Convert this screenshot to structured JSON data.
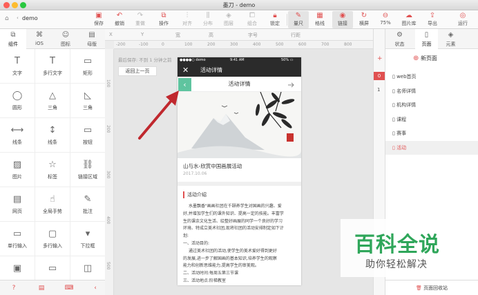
{
  "window": {
    "title": "墨刀 - demo",
    "doc_name": "demo"
  },
  "toolbar": {
    "items": [
      {
        "label": "保存",
        "icon": "save-icon"
      },
      {
        "label": "撤销",
        "icon": "undo-icon"
      },
      {
        "label": "重做",
        "icon": "redo-icon"
      },
      {
        "label": "操作",
        "icon": "operation-icon"
      },
      {
        "label": "对齐",
        "icon": "align-icon"
      },
      {
        "label": "分布",
        "icon": "distribute-icon"
      },
      {
        "label": "图层",
        "icon": "layer-icon"
      },
      {
        "label": "组合",
        "icon": "group-icon"
      },
      {
        "label": "锁定",
        "icon": "lock-icon"
      },
      {
        "label": "量尺",
        "icon": "ruler-icon"
      },
      {
        "label": "格线",
        "icon": "grid-icon"
      },
      {
        "label": "链接",
        "icon": "link-icon"
      },
      {
        "label": "横屏",
        "icon": "rotate-icon"
      },
      {
        "label": "75%",
        "icon": "zoom-icon"
      },
      {
        "label": "图片库",
        "icon": "image-library-icon"
      },
      {
        "label": "导出",
        "icon": "export-icon"
      },
      {
        "label": "运行",
        "icon": "run-icon"
      }
    ]
  },
  "left_tabs": [
    {
      "label": "组件",
      "icon": "component-icon"
    },
    {
      "label": "iOS",
      "icon": "apple-icon"
    },
    {
      "label": "图标",
      "icon": "emoji-icon"
    },
    {
      "label": "母版",
      "icon": "master-icon"
    }
  ],
  "components": [
    {
      "label": "文字",
      "icon": "T"
    },
    {
      "label": "多行文字",
      "icon": "T"
    },
    {
      "label": "矩形",
      "icon": "▭"
    },
    {
      "label": "圆形",
      "icon": "◯"
    },
    {
      "label": "三角",
      "icon": "△"
    },
    {
      "label": "三角",
      "icon": "◺"
    },
    {
      "label": "线条",
      "icon": "⟷"
    },
    {
      "label": "线条",
      "icon": "↕"
    },
    {
      "label": "按钮",
      "icon": "▭"
    },
    {
      "label": "图片",
      "icon": "▨"
    },
    {
      "label": "标签",
      "icon": "☆"
    },
    {
      "label": "链接区域",
      "icon": "⛓"
    },
    {
      "label": "网页",
      "icon": "▤"
    },
    {
      "label": "全局手势",
      "icon": "☝"
    },
    {
      "label": "批注",
      "icon": "✎"
    },
    {
      "label": "单行输入",
      "icon": "▭"
    },
    {
      "label": "多行输入",
      "icon": "▢"
    },
    {
      "label": "下拉框",
      "icon": "▾"
    },
    {
      "label": "",
      "icon": "▣"
    },
    {
      "label": "",
      "icon": "▭"
    },
    {
      "label": "",
      "icon": "◫"
    }
  ],
  "left_footer": [
    "help-icon",
    "doc-icon",
    "keyboard-icon",
    "collapse-icon"
  ],
  "propbar": {
    "x": "X",
    "y": "Y",
    "w": "宽",
    "h": "高",
    "font": "字号",
    "space": "行距"
  },
  "ruler_h": [
    "-200",
    "-100",
    "0",
    "100",
    "200",
    "300",
    "400",
    "500",
    "600",
    "700",
    "800"
  ],
  "ruler_v": [
    "100",
    "200",
    "300",
    "400",
    "500"
  ],
  "canvas": {
    "autosave": "最后保存: 不到 1 分钟之前",
    "back_button": "返回上一页"
  },
  "phone": {
    "status_left": "●●●●○ demo",
    "status_time": "9:41 AM",
    "status_right": "50% ▭",
    "nav_title": "活动详情",
    "sub_title": "活动详情",
    "card_title": "山与水-欣赏中国画展活动",
    "card_date": "2017.10.06",
    "section_title": "活动介绍",
    "body_lines": [
      "水墨飘香\"画画社团在千颐养学生对国画的兴趣、爱",
      "好,并增加学生们的课外知识、提高一定的技能。丰富学",
      "生的课余文化生活、绘整好画展的同学一个良好的学习",
      "环境、特成立美术社团,现将社团的活动安排制定如下计",
      "划:",
      "一、活动目的:",
      "通过美术社团的活动,使学生的美术爱好得到更好",
      "的发展,进一步了解国画的基本知识,培养学生的观察",
      "能力和创新思维能力,提高学生的审美观。",
      "二、活动时间:每周五第三节课",
      "三、活动地点:阶梯教室"
    ]
  },
  "layers": [
    "+",
    "0",
    "1"
  ],
  "right_tabs": [
    {
      "label": "状态",
      "icon": "state-icon"
    },
    {
      "label": "页面",
      "icon": "page-icon"
    },
    {
      "label": "元素",
      "icon": "element-icon"
    }
  ],
  "pages": {
    "new_page": "新页面",
    "items": [
      "web首页",
      "名师详情",
      "机构详情",
      "课程",
      "赛事",
      "活动"
    ],
    "selected_index": 5,
    "recycle": "页面回收站"
  },
  "watermark": {
    "title": "百科全说",
    "subtitle": "助你轻松解决"
  },
  "colors": {
    "accent": "#e05050",
    "back_green": "#5fc49f",
    "nav_dark": "#2b2b2b",
    "watermark_green": "#2fa65a",
    "arrow_red": "#c0282e"
  }
}
